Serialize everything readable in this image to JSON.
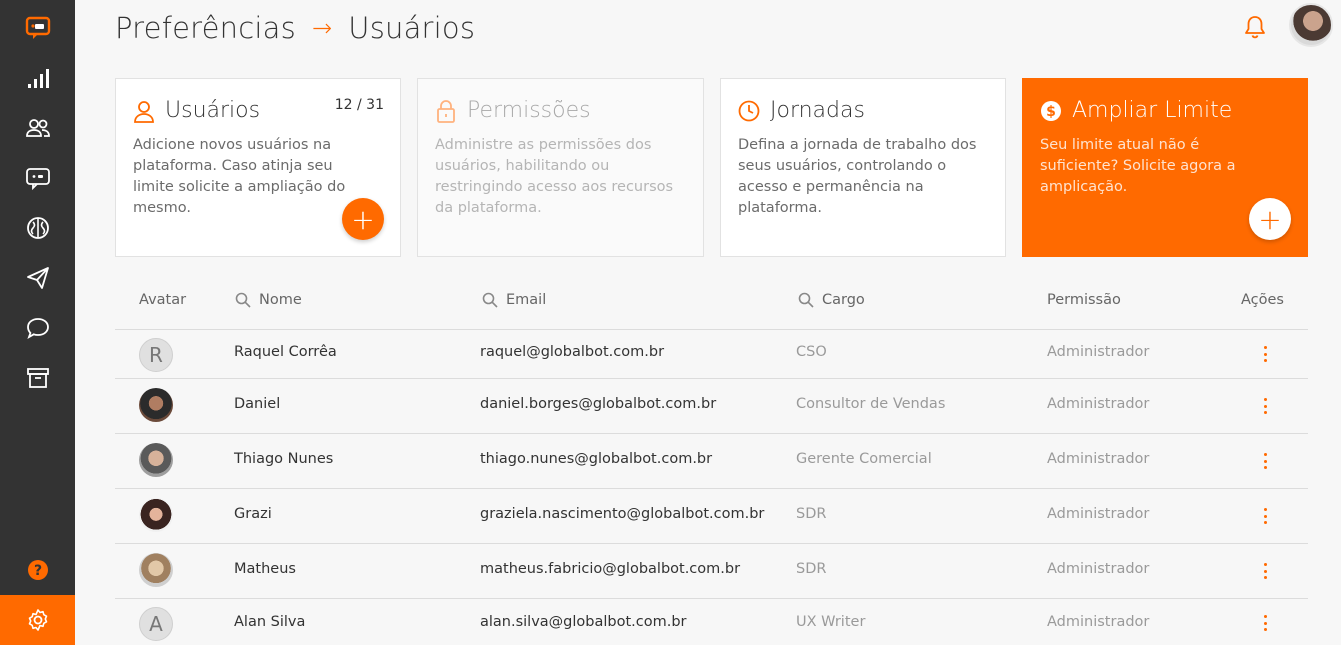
{
  "sidebar": {
    "items": [
      {
        "icon": "chat-bot-logo-icon"
      },
      {
        "icon": "signal-bars-icon"
      },
      {
        "icon": "users-icon"
      },
      {
        "icon": "chat-bot-icon"
      },
      {
        "icon": "brain-icon"
      },
      {
        "icon": "paper-plane-icon"
      },
      {
        "icon": "chat-bubble-icon"
      },
      {
        "icon": "archive-icon"
      }
    ],
    "help_icon": "question-circle-icon",
    "settings_icon": "gear-icon",
    "accent": "#ff6a00",
    "bg": "#333333"
  },
  "header": {
    "crumb_parent": "Preferências",
    "crumb_separator": "→",
    "crumb_current": "Usuários"
  },
  "cards": [
    {
      "title": "Usuários",
      "counter": "12 / 31",
      "description": "Adicione novos usuários na plataforma. Caso atinja seu limite solicite a ampliação do mesmo.",
      "fab": "+"
    },
    {
      "title": "Permissões",
      "description": "Administre as permissões dos usuários, habilitando ou restringindo acesso aos recursos da plataforma."
    },
    {
      "title": "Jornadas",
      "description": "Defina a jornada de trabalho dos seus usuários, controlando o acesso e permanência na plataforma."
    },
    {
      "title": "Ampliar Limite",
      "description": "Seu limite atual não é suficiente? Solicite agora a amplicação.",
      "fab": "+"
    }
  ],
  "table": {
    "headers": {
      "avatar": "Avatar",
      "name": "Nome",
      "email": "Email",
      "role": "Cargo",
      "permission": "Permissão",
      "actions": "Ações"
    },
    "rows": [
      {
        "avatar_letter": "R",
        "name": "Raquel Corrêa",
        "email": "raquel@globalbot.com.br",
        "role": "CSO",
        "permission": "Administrador"
      },
      {
        "avatar_letter": "",
        "name": "Daniel",
        "email": "daniel.borges@globalbot.com.br",
        "role": "Consultor de Vendas",
        "permission": "Administrador"
      },
      {
        "avatar_letter": "",
        "name": "Thiago Nunes",
        "email": "thiago.nunes@globalbot.com.br",
        "role": "Gerente Comercial",
        "permission": "Administrador"
      },
      {
        "avatar_letter": "",
        "name": "Grazi",
        "email": "graziela.nascimento@globalbot.com.br",
        "role": "SDR",
        "permission": "Administrador"
      },
      {
        "avatar_letter": "",
        "name": "Matheus",
        "email": "matheus.fabricio@globalbot.com.br",
        "role": "SDR",
        "permission": "Administrador"
      },
      {
        "avatar_letter": "A",
        "name": "Alan Silva",
        "email": "alan.silva@globalbot.com.br",
        "role": "UX Writer",
        "permission": "Administrador"
      }
    ]
  }
}
